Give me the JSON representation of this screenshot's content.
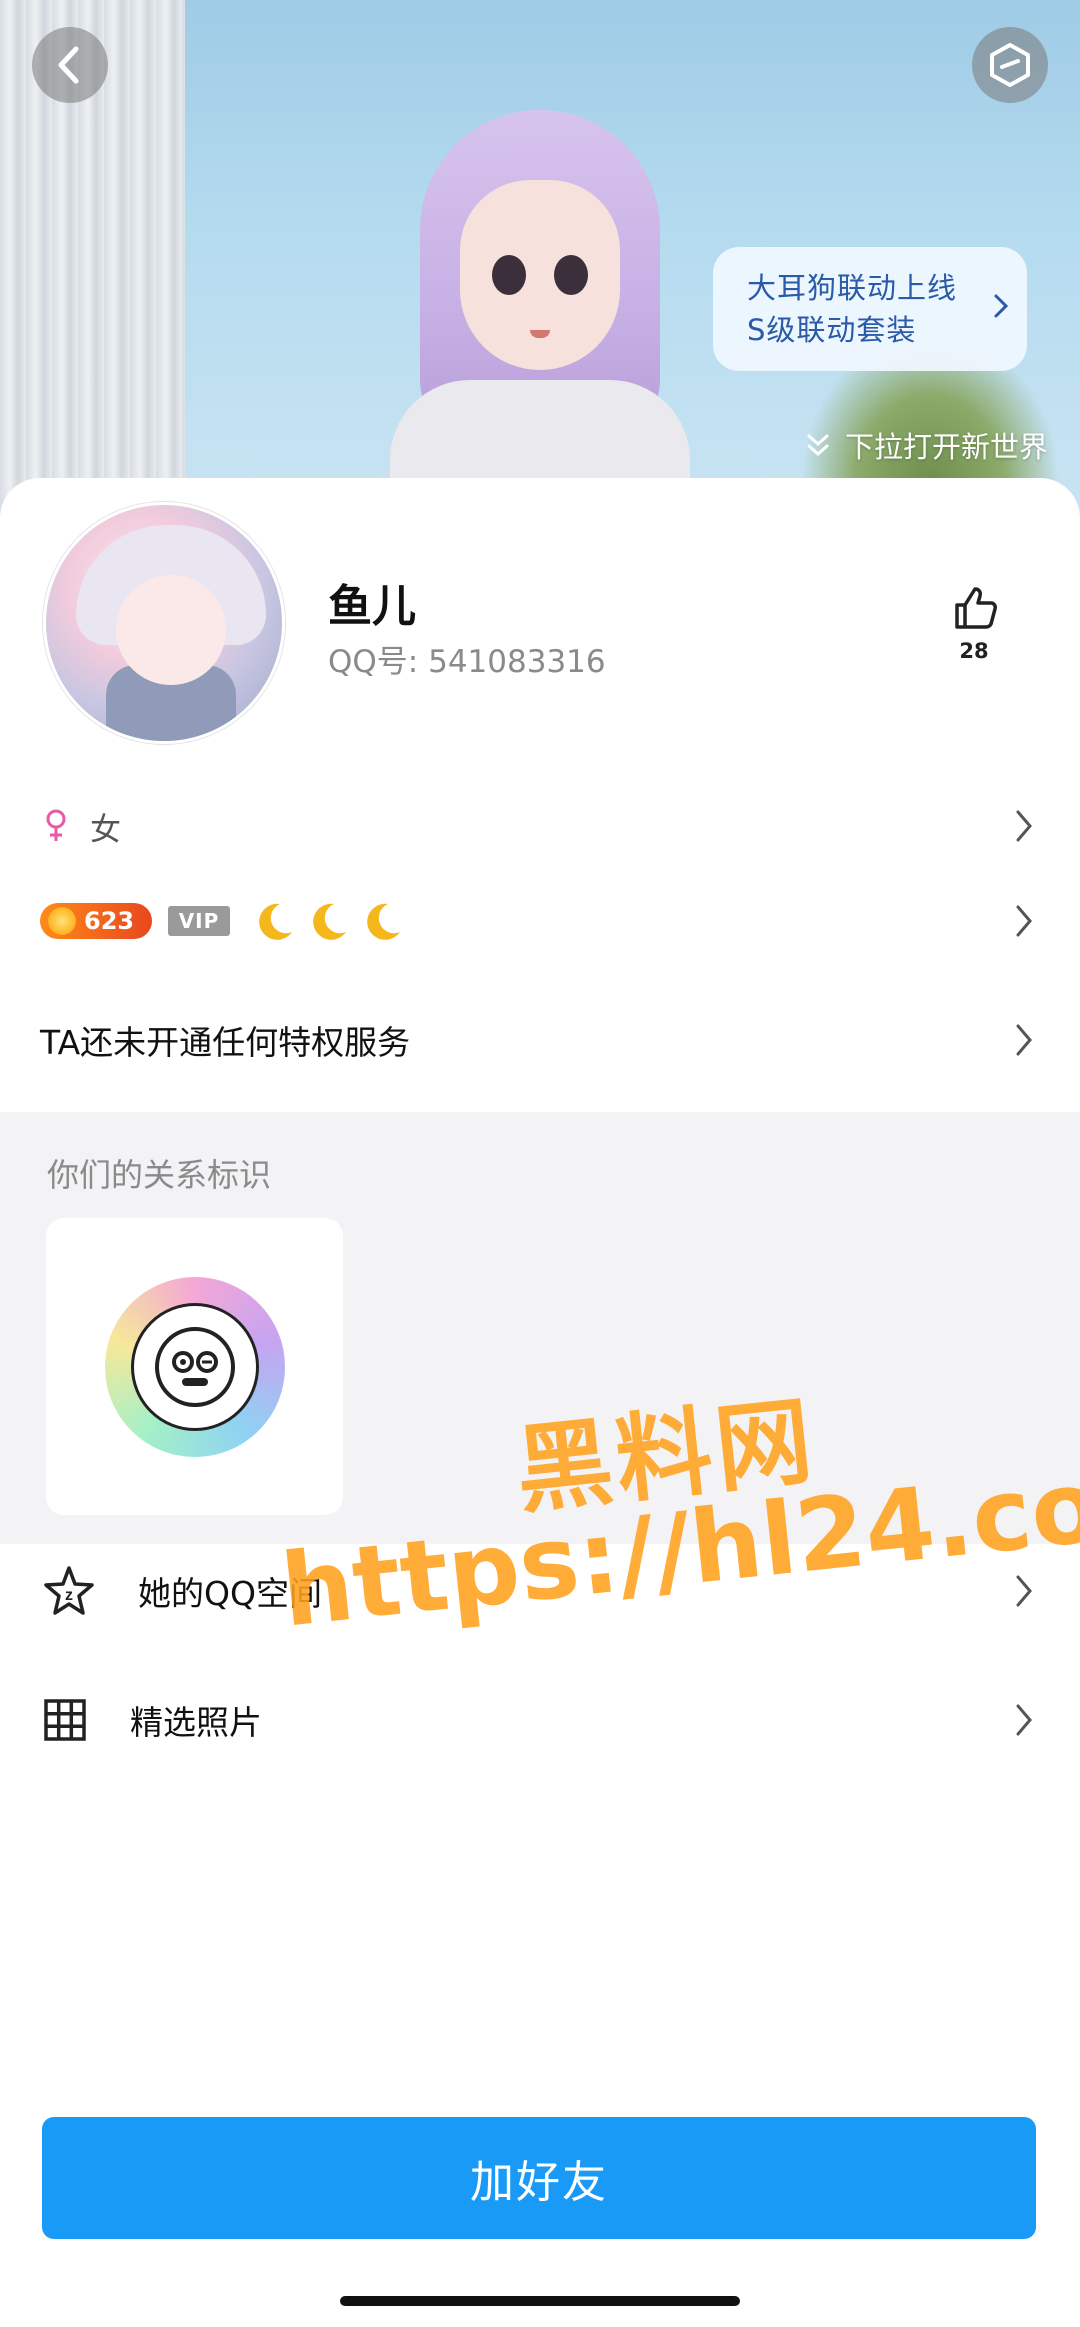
{
  "banner": {
    "promo_line1": "大耳狗联动上线",
    "promo_line2": "S级联动套装",
    "pull_hint": "下拉打开新世界"
  },
  "profile": {
    "nickname": "鱼儿",
    "qq_label": "QQ号: 541083316",
    "like_count": "28",
    "gender": "女",
    "level": "623",
    "vip_label": "VIP",
    "privilege_text": "TA还未开通任何特权服务"
  },
  "relation": {
    "title": "你们的关系标识"
  },
  "menu": {
    "qzone": "她的QQ空间",
    "photos": "精选照片"
  },
  "actions": {
    "add_friend": "加好友"
  },
  "watermark": {
    "line1": "黑料网",
    "line2": "https://hl24.co"
  },
  "colors": {
    "accent": "#1a9af7",
    "level_badge": "#ff8a1a",
    "gender_icon": "#e85aa6"
  }
}
